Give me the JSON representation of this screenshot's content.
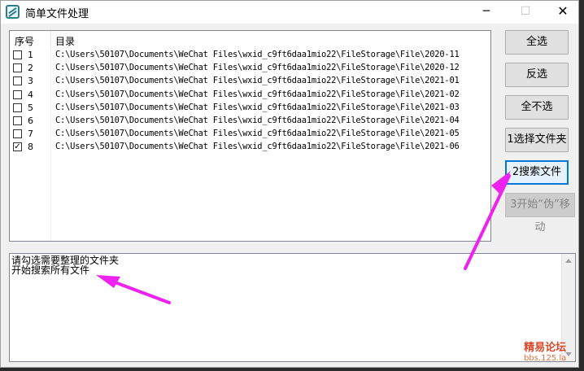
{
  "window": {
    "title": "简单文件处理",
    "controls": {
      "minimize": "─",
      "maximize": "☐",
      "close": "✕"
    }
  },
  "list": {
    "headers": {
      "no": "序号",
      "dir": "目录"
    },
    "rows": [
      {
        "index": "1",
        "checked": false,
        "path": "C:\\Users\\50107\\Documents\\WeChat Files\\wxid_c9ft6daa1mio22\\FileStorage\\File\\2020-11"
      },
      {
        "index": "2",
        "checked": false,
        "path": "C:\\Users\\50107\\Documents\\WeChat Files\\wxid_c9ft6daa1mio22\\FileStorage\\File\\2020-12"
      },
      {
        "index": "3",
        "checked": false,
        "path": "C:\\Users\\50107\\Documents\\WeChat Files\\wxid_c9ft6daa1mio22\\FileStorage\\File\\2021-01"
      },
      {
        "index": "4",
        "checked": false,
        "path": "C:\\Users\\50107\\Documents\\WeChat Files\\wxid_c9ft6daa1mio22\\FileStorage\\File\\2021-02"
      },
      {
        "index": "5",
        "checked": false,
        "path": "C:\\Users\\50107\\Documents\\WeChat Files\\wxid_c9ft6daa1mio22\\FileStorage\\File\\2021-03"
      },
      {
        "index": "6",
        "checked": false,
        "path": "C:\\Users\\50107\\Documents\\WeChat Files\\wxid_c9ft6daa1mio22\\FileStorage\\File\\2021-04"
      },
      {
        "index": "7",
        "checked": false,
        "path": "C:\\Users\\50107\\Documents\\WeChat Files\\wxid_c9ft6daa1mio22\\FileStorage\\File\\2021-05"
      },
      {
        "index": "8",
        "checked": true,
        "path": "C:\\Users\\50107\\Documents\\WeChat Files\\wxid_c9ft6daa1mio22\\FileStorage\\File\\2021-06"
      }
    ]
  },
  "buttons": {
    "select_all": "全选",
    "invert": "反选",
    "select_none": "全不选",
    "choose_folder": "1选择文件夹",
    "search_files": "2搜索文件",
    "start_move": "3开始“伪”移动"
  },
  "log": {
    "lines": [
      "请勾选需要整理的文件夹",
      "开始搜索所有文件"
    ]
  },
  "watermark": {
    "line1": "精易论坛",
    "line2": "bbs.125.la"
  },
  "colors": {
    "annotation_arrow": "#ee22ee",
    "focus_border": "#0078d7"
  }
}
